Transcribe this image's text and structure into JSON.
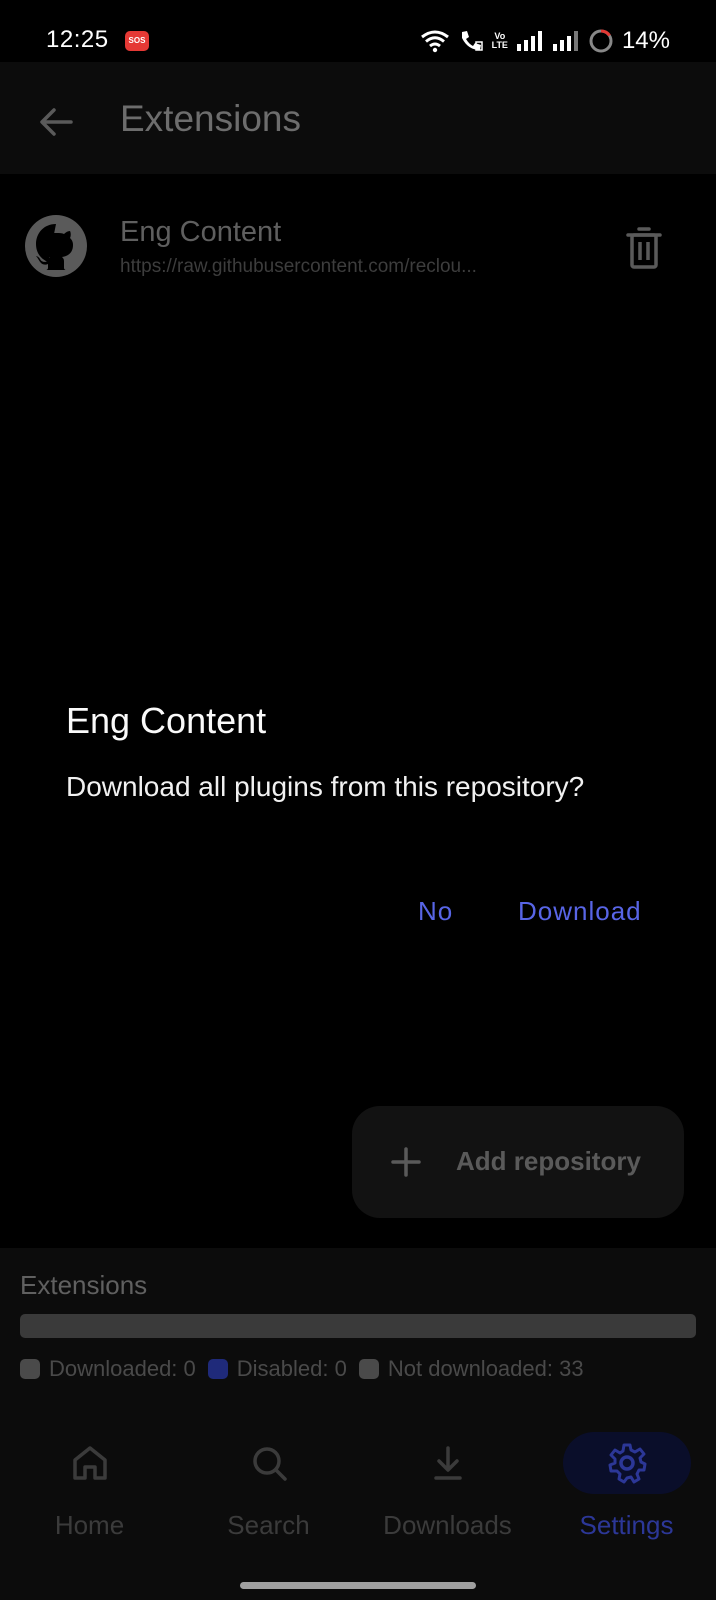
{
  "status_bar": {
    "time": "12:25",
    "sos_label": "SOS",
    "lte_top": "Vo",
    "lte_bottom": "LTE",
    "battery": "14%"
  },
  "app_bar": {
    "title": "Extensions",
    "back_icon": "arrow-left-icon"
  },
  "repository": {
    "name": "Eng Content",
    "url": "https://raw.githubusercontent.com/reclou...",
    "avatar_icon": "github-icon",
    "delete_icon": "trash-icon"
  },
  "dialog": {
    "title": "Eng Content",
    "message": "Download all plugins from this repository?",
    "no_label": "No",
    "download_label": "Download"
  },
  "fab": {
    "label": "Add repository",
    "icon": "plus-icon"
  },
  "stats": {
    "title": "Extensions",
    "legend": [
      {
        "label": "Downloaded: 0",
        "color": "#4a4a4a"
      },
      {
        "label": "Disabled: 0",
        "color": "#1f2a7a"
      },
      {
        "label": "Not downloaded: 33",
        "color": "#4a4a4a"
      }
    ]
  },
  "bottom_nav": {
    "items": [
      {
        "label": "Home",
        "icon": "home-icon",
        "active": false
      },
      {
        "label": "Search",
        "icon": "search-icon",
        "active": false
      },
      {
        "label": "Downloads",
        "icon": "download-icon",
        "active": false
      },
      {
        "label": "Settings",
        "icon": "gear-icon",
        "active": true
      }
    ]
  },
  "colors": {
    "accent": "#5865e6",
    "nav_active": "#2c3797",
    "background": "#000000"
  }
}
